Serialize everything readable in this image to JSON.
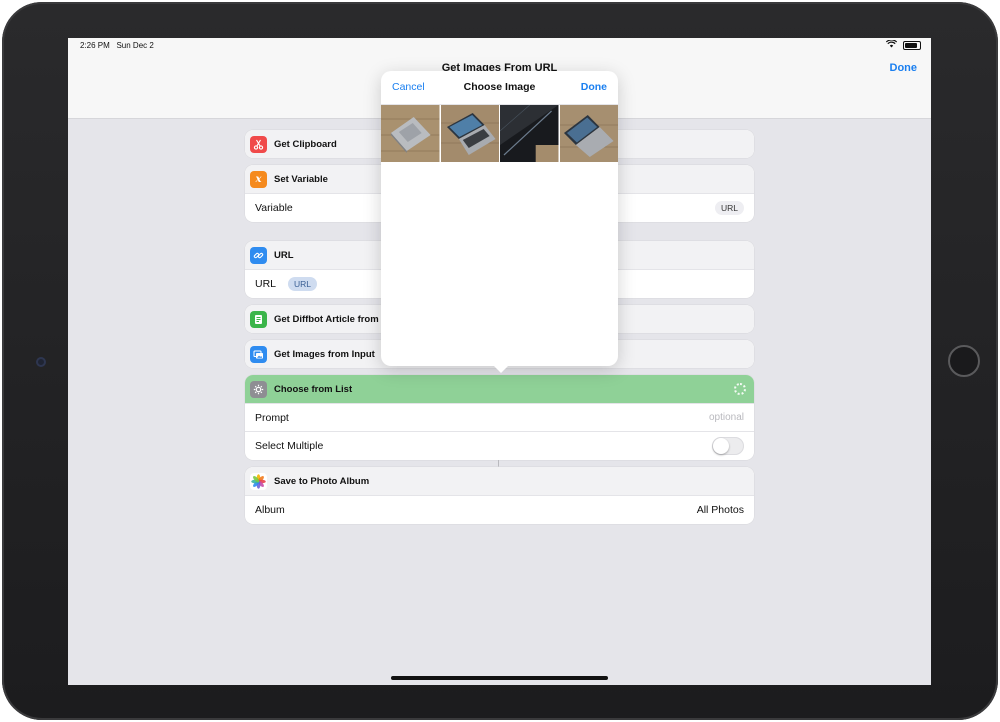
{
  "status": {
    "time": "2:26 PM",
    "date": "Sun Dec 2"
  },
  "nav": {
    "title": "Get Images From URL",
    "done": "Done"
  },
  "actions": [
    {
      "id": "get-clipboard",
      "title": "Get Clipboard",
      "icon": "scissors-icon",
      "color": "#f04a4a"
    },
    {
      "id": "set-variable",
      "title": "Set Variable",
      "icon": "variable-icon",
      "color": "#f58a1e",
      "row": {
        "label": "Variable",
        "value": "URL"
      }
    },
    {
      "id": "url",
      "title": "URL",
      "icon": "link-icon",
      "color": "#2f8cf0",
      "row": {
        "label": "URL",
        "value": "URL"
      }
    },
    {
      "id": "get-diffbot",
      "title": "Get Diffbot Article from",
      "icon": "article-icon",
      "color": "#3bb54a"
    },
    {
      "id": "get-images",
      "title": "Get Images from Input",
      "icon": "images-icon",
      "color": "#2f8cf0"
    },
    {
      "id": "choose-from-list",
      "title": "Choose from List",
      "icon": "gear-icon",
      "color": "#8e8e93",
      "rows": [
        {
          "label": "Prompt",
          "placeholder": "optional"
        },
        {
          "label": "Select Multiple"
        }
      ]
    },
    {
      "id": "save-photo",
      "title": "Save to Photo Album",
      "icon": "photos-icon",
      "row": {
        "label": "Album",
        "value": "All Photos"
      }
    }
  ],
  "picker": {
    "cancel": "Cancel",
    "title": "Choose Image",
    "done": "Done",
    "images": [
      "laptop-photo-1",
      "laptop-photo-2",
      "laptop-photo-3",
      "laptop-photo-4"
    ]
  }
}
